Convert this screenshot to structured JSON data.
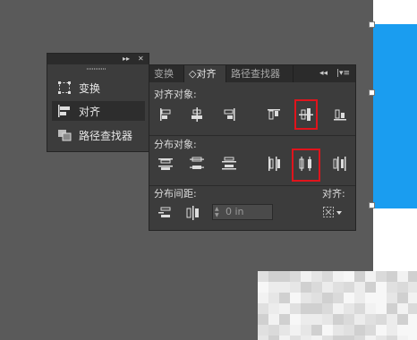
{
  "mini_panel": {
    "items": [
      {
        "label": "变换",
        "icon": "transform-icon"
      },
      {
        "label": "对齐",
        "icon": "align-icon"
      },
      {
        "label": "路径查找器",
        "icon": "pathfinder-icon"
      }
    ],
    "selected_index": 1,
    "controls": {
      "collapse": "▸▸",
      "close": "✕"
    }
  },
  "align_panel": {
    "tabs": [
      {
        "label": "变换",
        "active": false
      },
      {
        "label": "◇对齐",
        "active": true
      },
      {
        "label": "路径查找器",
        "active": false
      }
    ],
    "tab_controls": {
      "collapse": "◂◂",
      "menu": "|▾≡"
    },
    "align_objects": {
      "label": "对齐对象:",
      "buttons": [
        "align-left-icon",
        "align-horizontal-center-icon",
        "align-right-icon",
        "align-top-icon",
        "align-vertical-center-icon",
        "align-bottom-icon"
      ],
      "highlighted_index": 4
    },
    "distribute_objects": {
      "label": "分布对象:",
      "buttons": [
        "distribute-top-icon",
        "distribute-vertical-center-icon",
        "distribute-bottom-icon",
        "distribute-left-icon",
        "distribute-horizontal-center-icon",
        "distribute-right-icon"
      ],
      "highlighted_index": 4
    },
    "distribute_spacing": {
      "label": "分布间距:",
      "align_to_label": "对齐:",
      "value": "0 in"
    }
  },
  "colors": {
    "canvas": "#5a5a5a",
    "panel": "#3c3c3c",
    "highlight": "#e0141c",
    "artboard_blue": "#1a9df0"
  }
}
